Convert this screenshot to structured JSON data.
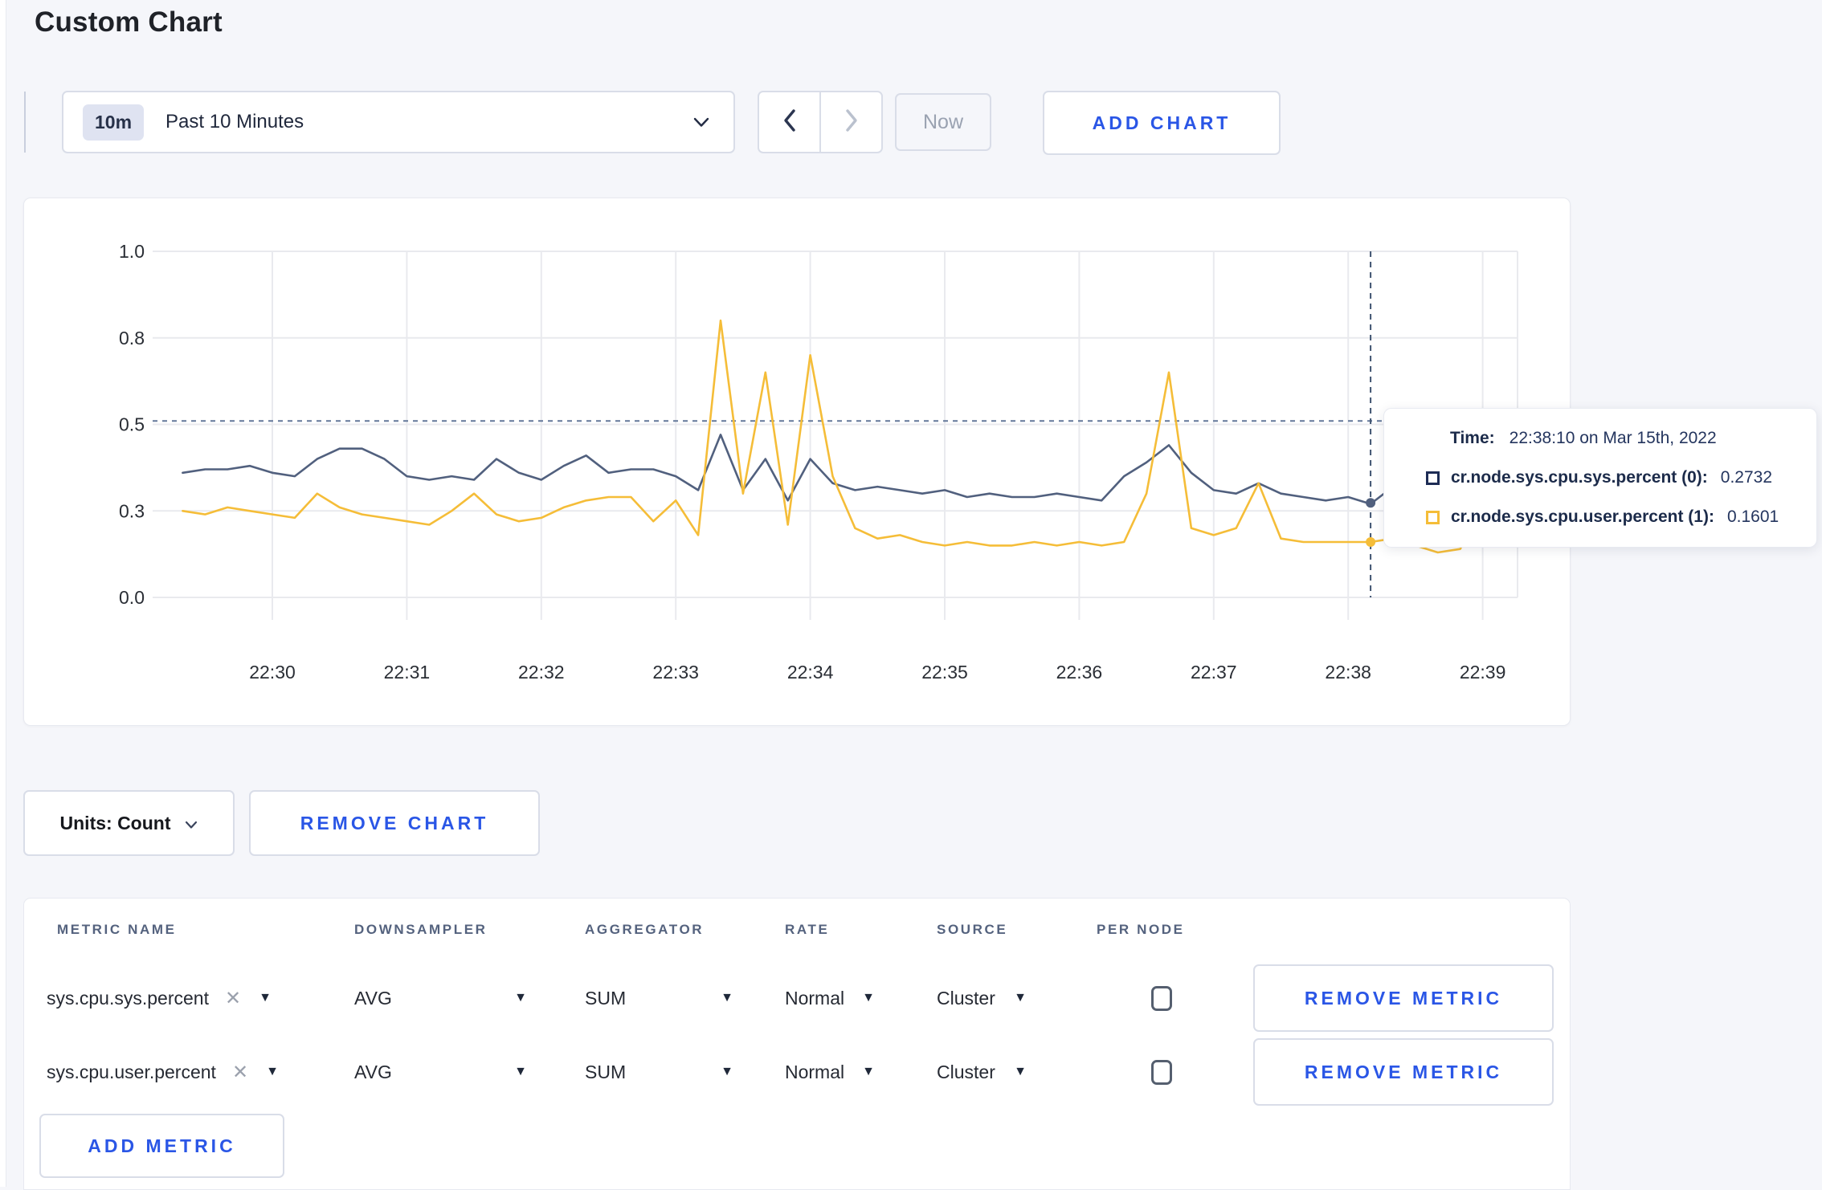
{
  "page": {
    "title": "Custom Chart"
  },
  "toolbar": {
    "range_badge": "10m",
    "range_label": "Past 10 Minutes",
    "now_label": "Now",
    "add_chart_label": "ADD CHART"
  },
  "chart_data": {
    "type": "line",
    "title": "",
    "xlabel": "",
    "ylabel": "",
    "ylim": [
      0,
      1
    ],
    "grid": true,
    "start_time": "22:29:20",
    "interval_sec": 10,
    "x_tick_labels": [
      "22:30",
      "22:31",
      "22:32",
      "22:33",
      "22:34",
      "22:35",
      "22:36",
      "22:37",
      "22:38",
      "22:39"
    ],
    "y_tick_values": [
      0,
      0.25,
      0.5,
      0.75,
      1.0
    ],
    "y_tick_labels": [
      "0.0",
      "0.3",
      "0.5",
      "0.8",
      "1.0"
    ],
    "series": [
      {
        "name": "cr.node.sys.cpu.sys.percent",
        "color": "#51607e",
        "values": [
          0.36,
          0.37,
          0.37,
          0.38,
          0.36,
          0.35,
          0.4,
          0.43,
          0.43,
          0.4,
          0.35,
          0.34,
          0.35,
          0.34,
          0.4,
          0.36,
          0.34,
          0.38,
          0.41,
          0.36,
          0.37,
          0.37,
          0.35,
          0.31,
          0.47,
          0.31,
          0.4,
          0.28,
          0.4,
          0.33,
          0.31,
          0.32,
          0.31,
          0.3,
          0.31,
          0.29,
          0.3,
          0.29,
          0.29,
          0.3,
          0.29,
          0.28,
          0.35,
          0.39,
          0.44,
          0.36,
          0.31,
          0.3,
          0.33,
          0.3,
          0.29,
          0.28,
          0.29,
          0.27,
          0.32,
          0.3,
          0.3,
          0.29,
          0.31,
          0.3
        ]
      },
      {
        "name": "cr.node.sys.cpu.user.percent",
        "color": "#f5bd38",
        "values": [
          0.25,
          0.24,
          0.26,
          0.25,
          0.24,
          0.23,
          0.3,
          0.26,
          0.24,
          0.23,
          0.22,
          0.21,
          0.25,
          0.3,
          0.24,
          0.22,
          0.23,
          0.26,
          0.28,
          0.29,
          0.29,
          0.22,
          0.28,
          0.18,
          0.8,
          0.3,
          0.65,
          0.21,
          0.7,
          0.35,
          0.2,
          0.17,
          0.18,
          0.16,
          0.15,
          0.16,
          0.15,
          0.15,
          0.16,
          0.15,
          0.16,
          0.15,
          0.16,
          0.3,
          0.65,
          0.2,
          0.18,
          0.2,
          0.33,
          0.17,
          0.16,
          0.16,
          0.16,
          0.16,
          0.17,
          0.15,
          0.13,
          0.14,
          0.27,
          0.24
        ]
      }
    ],
    "hover": {
      "time": "22:38:10",
      "offset_sec": 530,
      "hline_value": 0.51,
      "point_values": [
        0.2732,
        0.1601
      ]
    },
    "legend_position": "tooltip"
  },
  "tooltip": {
    "time_label": "Time:",
    "time_value": "22:38:10 on Mar 15th, 2022",
    "rows": [
      {
        "name": "cr.node.sys.cpu.sys.percent (0):",
        "value": "0.2732",
        "color": "#1d2c55"
      },
      {
        "name": "cr.node.sys.cpu.user.percent (1):",
        "value": "0.1601",
        "color": "#f5bd38"
      }
    ]
  },
  "chart_footer": {
    "units_label": "Units: Count",
    "remove_chart_label": "REMOVE CHART"
  },
  "metrics_table": {
    "headers": [
      "METRIC NAME",
      "DOWNSAMPLER",
      "AGGREGATOR",
      "RATE",
      "SOURCE",
      "PER NODE"
    ],
    "rows": [
      {
        "metric": "sys.cpu.sys.percent",
        "downsampler": "AVG",
        "aggregator": "SUM",
        "rate": "Normal",
        "source": "Cluster",
        "per_node_checked": false,
        "remove_label": "REMOVE METRIC"
      },
      {
        "metric": "sys.cpu.user.percent",
        "downsampler": "AVG",
        "aggregator": "SUM",
        "rate": "Normal",
        "source": "Cluster",
        "per_node_checked": false,
        "remove_label": "REMOVE METRIC"
      }
    ],
    "add_metric_label": "ADD METRIC"
  },
  "colors": {
    "accent_blue": "#2a56e6",
    "page_bg": "#f5f6fa",
    "grid_line": "#e9eaee",
    "crosshair_h": "#64789a",
    "crosshair_v": "#3f5471",
    "series_sys": "#51607e",
    "series_user": "#f5bd38"
  }
}
